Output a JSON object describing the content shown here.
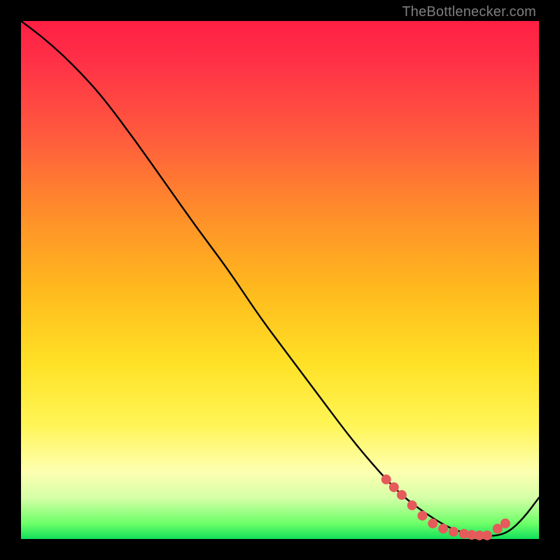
{
  "credit": "TheBottlenecker.com",
  "colors": {
    "curve_stroke": "#000000",
    "marker_fill": "#e55a5a",
    "background": "#000000"
  },
  "chart_data": {
    "type": "line",
    "title": "",
    "xlabel": "",
    "ylabel": "",
    "xlim": [
      0,
      100
    ],
    "ylim": [
      0,
      100
    ],
    "curve": {
      "x": [
        0,
        4,
        8,
        12,
        16,
        22,
        28,
        34,
        40,
        46,
        52,
        58,
        64,
        70,
        74,
        78,
        82,
        85,
        88,
        91,
        94,
        97,
        100
      ],
      "y": [
        100,
        97,
        93.5,
        89.5,
        85,
        77,
        68.5,
        60,
        52,
        43,
        35,
        27,
        19,
        12,
        8,
        5,
        2.5,
        1.3,
        0.7,
        0.5,
        1.2,
        4,
        8
      ]
    },
    "markers": {
      "x": [
        70.5,
        72,
        73.5,
        75.5,
        77.5,
        79.5,
        81.5,
        83.5,
        85.5,
        87,
        88.5,
        90,
        92,
        93.5
      ],
      "y": [
        11.5,
        10.0,
        8.5,
        6.5,
        4.5,
        3.0,
        2.0,
        1.4,
        1.0,
        0.8,
        0.7,
        0.7,
        2.0,
        3.0
      ]
    }
  }
}
